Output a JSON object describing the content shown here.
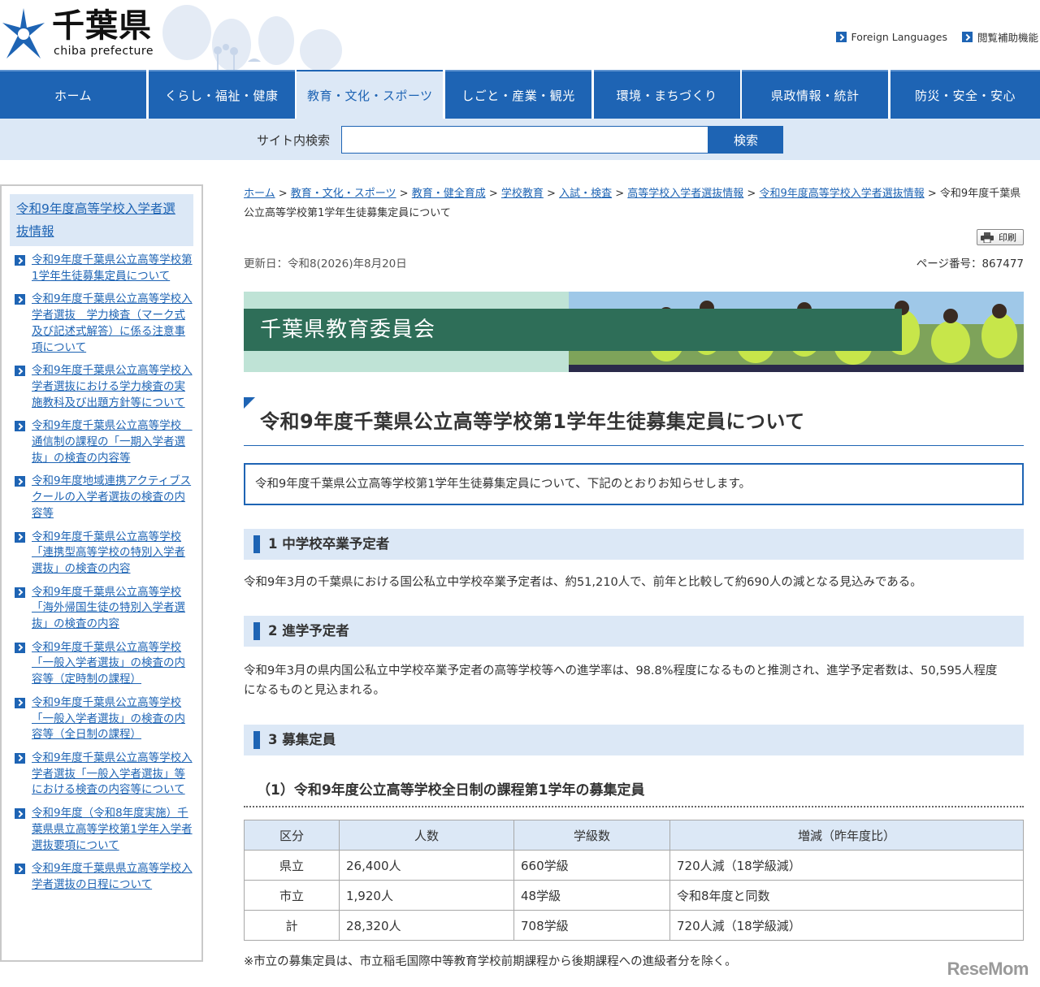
{
  "header": {
    "logo_jp": "千葉県",
    "logo_en": "chiba prefecture",
    "links": [
      "Foreign Languages",
      "閲覧補助機能"
    ]
  },
  "nav": [
    "ホーム",
    "くらし・福祉・健康",
    "教育・文化・スポーツ",
    "しごと・産業・観光",
    "環境・まちづくり",
    "県政情報・統計",
    "防災・安全・安心"
  ],
  "search": {
    "label": "サイト内検索",
    "button": "検索",
    "value": ""
  },
  "sidebar": {
    "title": "令和9年度高等学校入学者選抜情報",
    "items": [
      "令和9年度千葉県公立高等学校第1学年生徒募集定員について",
      "令和9年度千葉県公立高等学校入学者選抜　学力検査（マーク式及び記述式解答）に係る注意事項について",
      "令和9年度千葉県公立高等学校入学者選抜における学力検査の実施教科及び出題方針等について",
      "令和9年度千葉県公立高等学校　通信制の課程の「一期入学者選抜」の検査の内容等",
      "令和9年度地域連携アクティブスクールの入学者選抜の検査の内容等",
      "令和9年度千葉県公立高等学校「連携型高等学校の特別入学者選抜」の検査の内容",
      "令和9年度千葉県公立高等学校「海外帰国生徒の特別入学者選抜」の検査の内容",
      "令和9年度千葉県公立高等学校「一般入学者選抜」の検査の内容等（定時制の課程）",
      "令和9年度千葉県公立高等学校「一般入学者選抜」の検査の内容等（全日制の課程）",
      "令和9年度千葉県公立高等学校入学者選抜「一般入学者選抜」等における検査の内容等について",
      "令和9年度（令和8年度実施）千葉県県立高等学校第1学年入学者選抜要項について",
      "令和9年度千葉県県立高等学校入学者選抜の日程について"
    ]
  },
  "breadcrumb": {
    "links": [
      "ホーム",
      "教育・文化・スポーツ",
      "教育・健全育成",
      "学校教育",
      "入試・検査",
      "高等学校入学者選抜情報",
      "令和9年度高等学校入学者選抜情報"
    ],
    "current": "令和9年度千葉県公立高等学校第1学年生徒募集定員について"
  },
  "print_label": "印刷",
  "updated": "更新日：令和8(2026)年8月20日",
  "page_number": "ページ番号：867477",
  "banner_title": "千葉県教育委員会",
  "page_title": "令和9年度千葉県公立高等学校第1学年生徒募集定員について",
  "intro": "令和9年度千葉県公立高等学校第1学年生徒募集定員について、下記のとおりお知らせします。",
  "sections": [
    {
      "heading": "1 中学校卒業予定者",
      "body": "令和9年3月の千葉県における国公私立中学校卒業予定者は、約51,210人で、前年と比較して約690人の減となる見込みである。"
    },
    {
      "heading": "2 進学予定者",
      "body": "令和9年3月の県内国公私立中学校卒業予定者の高等学校等への進学率は、98.8%程度になるものと推測され、進学予定者数は、50,595人程度になるものと見込まれる。"
    },
    {
      "heading": "3 募集定員",
      "body": ""
    }
  ],
  "subheading": "（1）令和9年度公立高等学校全日制の課程第1学年の募集定員",
  "table": {
    "headers": [
      "区分",
      "人数",
      "学級数",
      "増減（昨年度比）"
    ],
    "rows": [
      [
        "県立",
        "26,400人",
        "660学級",
        "720人減（18学級減）"
      ],
      [
        "市立",
        "1,920人",
        "48学級",
        "令和8年度と同数"
      ],
      [
        "計",
        "28,320人",
        "708学級",
        "720人減（18学級減）"
      ]
    ]
  },
  "note": "※市立の募集定員は、市立稲毛国際中等教育学校前期課程から後期課程への進級者分を除く。",
  "watermark": "ReseMom"
}
